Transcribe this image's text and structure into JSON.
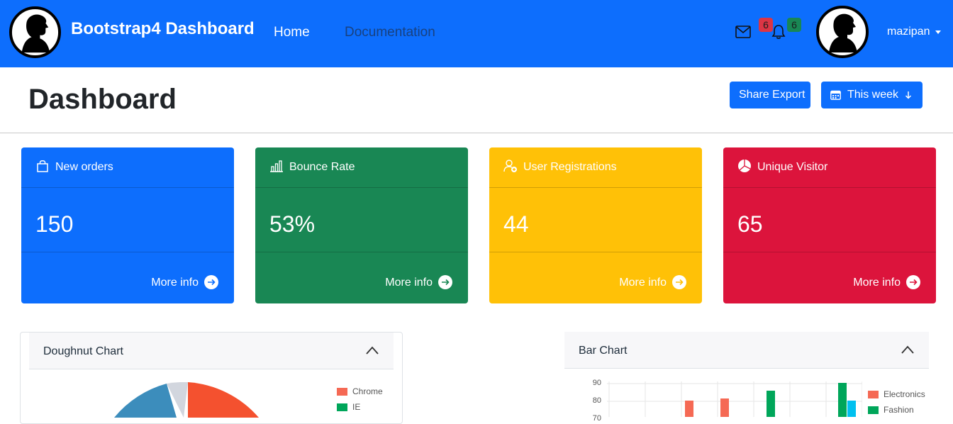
{
  "navbar": {
    "brand": "Bootstrap4 Dashboard",
    "links": [
      {
        "label": "Home"
      },
      {
        "label": "Documentation"
      }
    ],
    "mail_badge": "6",
    "bell_badge": "6",
    "username": "mazipan"
  },
  "header": {
    "title": "Dashboard",
    "share_export_label": "Share Export",
    "week_label": "This week"
  },
  "cards": [
    {
      "title": "New orders",
      "value": "150",
      "more": "More info",
      "icon": "shopping-bag-icon",
      "color": "#0d6efd"
    },
    {
      "title": "Bounce Rate",
      "value": "53%",
      "more": "More info",
      "icon": "bar-chart-icon",
      "color": "#198754"
    },
    {
      "title": "User Registrations",
      "value": "44",
      "more": "More info",
      "icon": "user-plus-icon",
      "color": "#ffc107"
    },
    {
      "title": "Unique Visitor",
      "value": "65",
      "more": "More info",
      "icon": "pie-chart-icon",
      "color": "#dc143c"
    }
  ],
  "panels": {
    "doughnut_title": "Doughnut Chart",
    "bar_title": "Bar Chart"
  },
  "chart_data": [
    {
      "type": "pie",
      "title": "",
      "legend": [
        "Chrome",
        "IE"
      ],
      "colors": [
        "#f56954",
        "#00a65a",
        "#3c8dbc",
        "#d2d6de"
      ],
      "legend_position": "right"
    },
    {
      "type": "bar",
      "title": "",
      "legend": [
        "Electronics",
        "Fashion"
      ],
      "colors": [
        "#f56954",
        "#00a65a",
        "#00c0ef"
      ],
      "yticks": [
        90,
        80,
        70
      ],
      "legend_position": "right"
    }
  ]
}
